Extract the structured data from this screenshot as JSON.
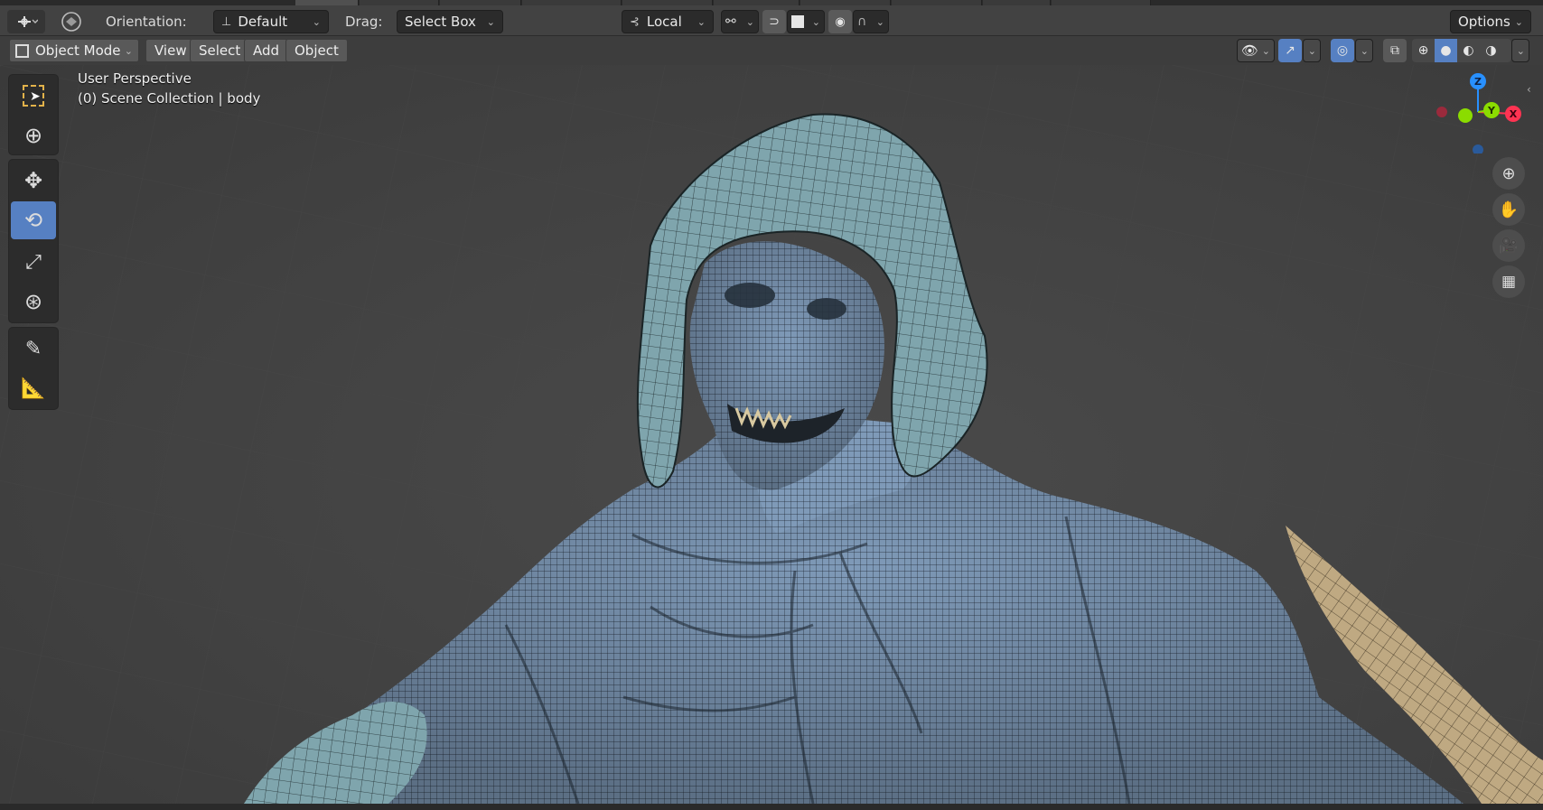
{
  "header": {
    "orientation_label": "Orientation:",
    "orientation_value": "Default",
    "drag_label": "Drag:",
    "drag_value": "Select Box",
    "pivot_value": "Local",
    "options_label": "Options"
  },
  "menubar": {
    "mode_label": "Object Mode",
    "view_label": "View",
    "select_label": "Select",
    "add_label": "Add",
    "object_label": "Object"
  },
  "viewport": {
    "view_name": "User Perspective",
    "collection_info": "(0) Scene Collection | body"
  },
  "gizmo": {
    "x_label": "X",
    "y_label": "Y",
    "z_label": "Z",
    "x_color": "#ff3352",
    "y_color": "#8bdc00",
    "z_color": "#2890ff"
  },
  "colors": {
    "accent": "#5680c2",
    "mesh_body": "#7f9ab8",
    "mesh_hood": "#7fa5ad",
    "mesh_spear": "#bfa982",
    "viewport_bg": "#414141"
  },
  "toolbar_icons": [
    "select-box-icon",
    "cursor-icon",
    "move-icon",
    "rotate-icon",
    "scale-icon",
    "transform-icon",
    "annotate-icon",
    "measure-icon"
  ]
}
